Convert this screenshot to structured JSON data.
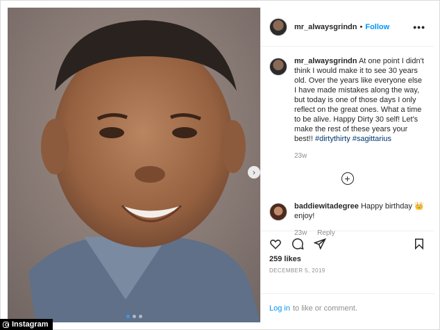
{
  "post": {
    "username": "mr_alwaysgrindn",
    "follow_label": "Follow",
    "separator": "•",
    "more_label": "•••",
    "caption": "At one point I didn't think I would make it to see 30 years old. Over the years like everyone else I have made mistakes along the way, but today is one of those days I only reflect on the great ones. What a time to be alive. Happy Dirty 30 self! Let's make the rest of these years your best!!",
    "hashtags": "#dirtythirty #sagittarius",
    "caption_age": "23w",
    "load_more_label": "+",
    "likes": "259 likes",
    "date": "DECEMBER 5, 2019"
  },
  "comments": [
    {
      "username": "baddiewitadegree",
      "text": "Happy birthday 👑 enjoy!",
      "age": "23w",
      "reply_label": "Reply"
    }
  ],
  "login": {
    "link_label": "Log in",
    "suffix": "to like or comment."
  },
  "carousel": {
    "next_arrow": "›",
    "dot_count": 3,
    "active_dot": 0
  },
  "credit": {
    "label": "Instagram"
  },
  "icons": {
    "like": "heart-icon",
    "comment": "comment-icon",
    "share": "share-icon",
    "save": "bookmark-icon"
  },
  "colors": {
    "link": "#0095f6",
    "hashtag": "#00376b",
    "muted": "#8e8e8e",
    "active_dot": "#3897f0"
  }
}
